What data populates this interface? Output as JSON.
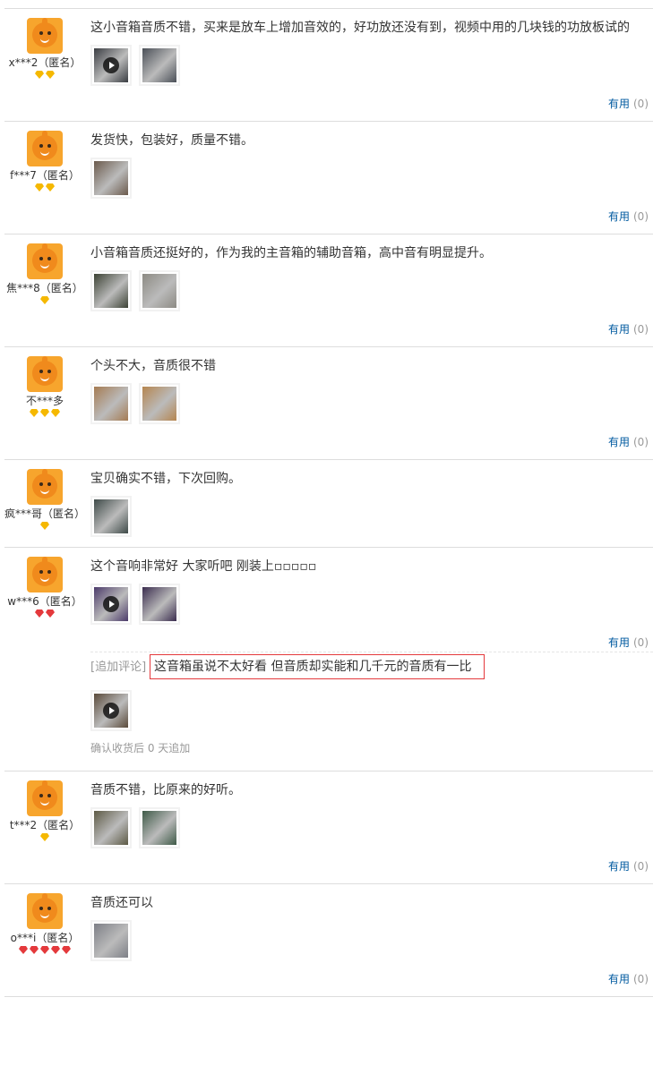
{
  "reviews": [
    {
      "user": "x***2（匿名）",
      "rank": "yellow",
      "rank_count": 2,
      "text": "这小音箱音质不错，买来是放车上增加音效的，好功放还没有到，视频中用的几块钱的功放板试的",
      "pics": [
        {
          "video": true,
          "color": "#3a3d42"
        },
        {
          "video": false,
          "color": "#4a4f57"
        }
      ],
      "useful": "有用",
      "count": "(0)"
    },
    {
      "user": "f***7（匿名）",
      "rank": "yellow",
      "rank_count": 2,
      "text": "发货快，包装好，质量不错。",
      "pics": [
        {
          "video": false,
          "color": "#6b5a4c"
        }
      ],
      "useful": "有用",
      "count": "(0)"
    },
    {
      "user": "焦***8（匿名）",
      "rank": "yellow",
      "rank_count": 1,
      "text": "小音箱音质还挺好的，作为我的主音箱的辅助音箱，高中音有明显提升。",
      "pics": [
        {
          "video": false,
          "color": "#3c4234"
        },
        {
          "video": false,
          "color": "#8c8a83"
        }
      ],
      "useful": "有用",
      "count": "(0)"
    },
    {
      "user": "不***多",
      "rank": "yellow",
      "rank_count": 3,
      "text": "个头不大，音质很不错",
      "pics": [
        {
          "video": false,
          "color": "#a57b52"
        },
        {
          "video": false,
          "color": "#b5854f"
        }
      ],
      "useful": "有用",
      "count": "(0)"
    },
    {
      "user": "疯***哥（匿名）",
      "rank": "yellow",
      "rank_count": 1,
      "text": "宝贝确实不错，下次回购。",
      "pics": [
        {
          "video": false,
          "color": "#3e4a48"
        }
      ],
      "useful": "有用",
      "count": "(0)"
    },
    {
      "user": "w***6（匿名）",
      "rank": "red",
      "rank_count": 2,
      "text": "这个音响非常好 大家听吧 刚装上▫▫▫▫▫",
      "pics": [
        {
          "video": true,
          "color": "#4b3a6a"
        },
        {
          "video": false,
          "color": "#3a2c4e"
        }
      ],
      "useful": "有用",
      "count": "(0)",
      "append": {
        "tag": "[追加评论]",
        "text": "这音箱虽说不太好看 但音质却实能和几千元的音质有一比",
        "pics": [
          {
            "video": true,
            "color": "#5a4a3a"
          }
        ],
        "note": "确认收货后 0 天追加"
      }
    },
    {
      "user": "t***2（匿名）",
      "rank": "yellow",
      "rank_count": 1,
      "text": "音质不错，比原来的好听。",
      "pics": [
        {
          "video": false,
          "color": "#5d5a45"
        },
        {
          "video": false,
          "color": "#3e5a47"
        }
      ],
      "useful": "有用",
      "count": "(0)"
    },
    {
      "user": "o***i（匿名）",
      "rank": "red",
      "rank_count": 5,
      "text": "音质还可以",
      "pics": [
        {
          "video": false,
          "color": "#7d7f86"
        }
      ],
      "useful": "有用",
      "count": "(0)"
    }
  ]
}
